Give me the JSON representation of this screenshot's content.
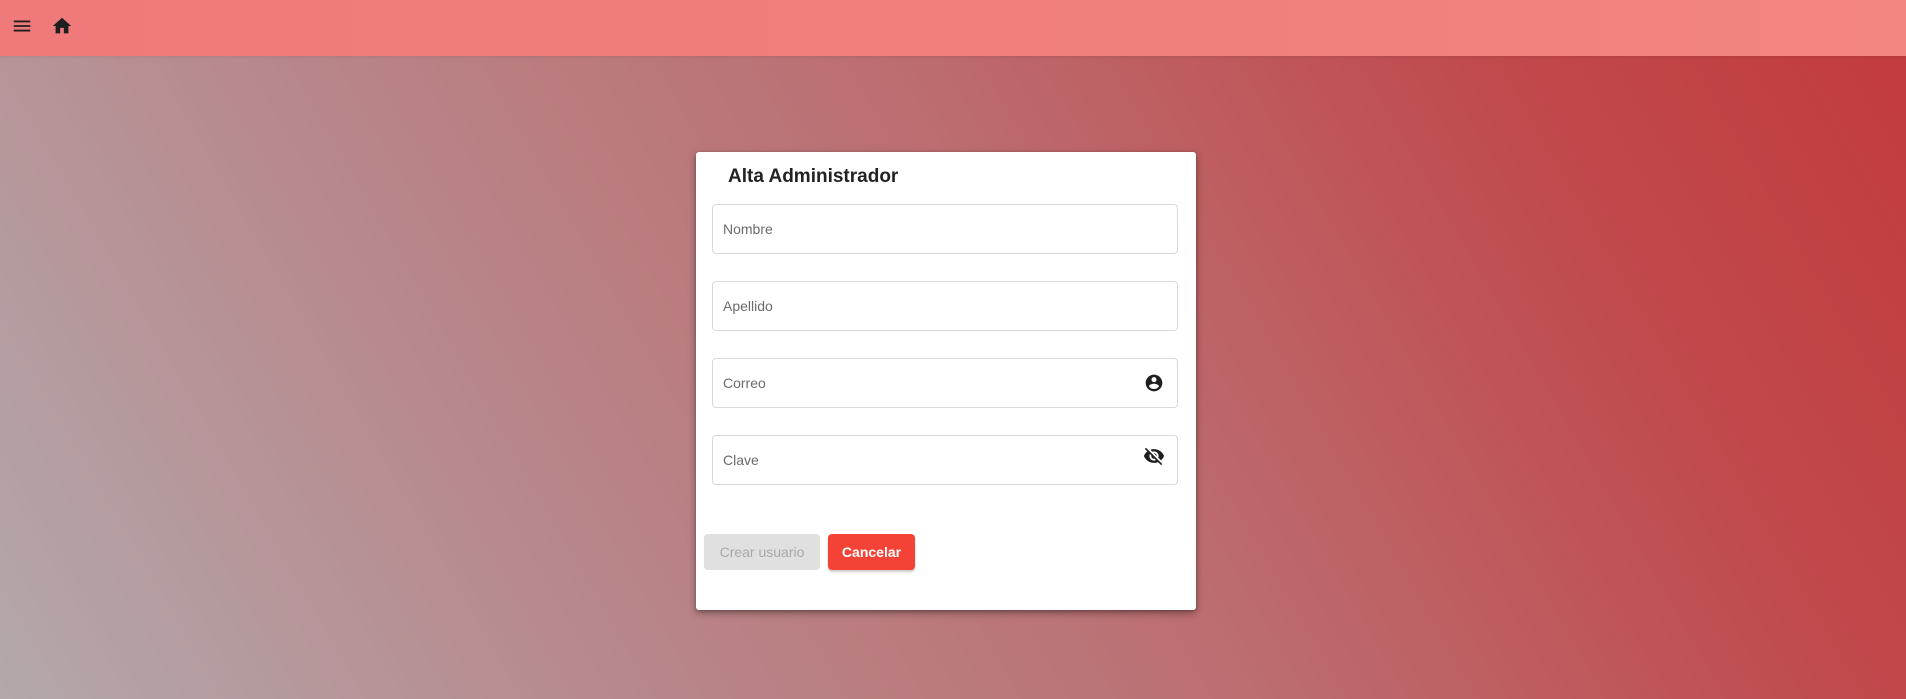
{
  "toolbar": {
    "menu_icon": "menu-icon",
    "home_icon": "home-icon",
    "background_color": "#f07a7a"
  },
  "form": {
    "title": "Alta Administrador",
    "fields": {
      "nombre": {
        "placeholder": "Nombre",
        "value": ""
      },
      "apellido": {
        "placeholder": "Apellido",
        "value": ""
      },
      "correo": {
        "placeholder": "Correo",
        "value": "",
        "icon": "account-circle-icon"
      },
      "clave": {
        "placeholder": "Clave",
        "value": "",
        "icon": "visibility-off-icon"
      }
    },
    "buttons": {
      "create_label": "Crear usuario",
      "cancel_label": "Cancelar"
    }
  },
  "colors": {
    "accent": "#f44336",
    "disabled_bg": "#e0e0e0",
    "disabled_text": "#a8a8a8"
  }
}
